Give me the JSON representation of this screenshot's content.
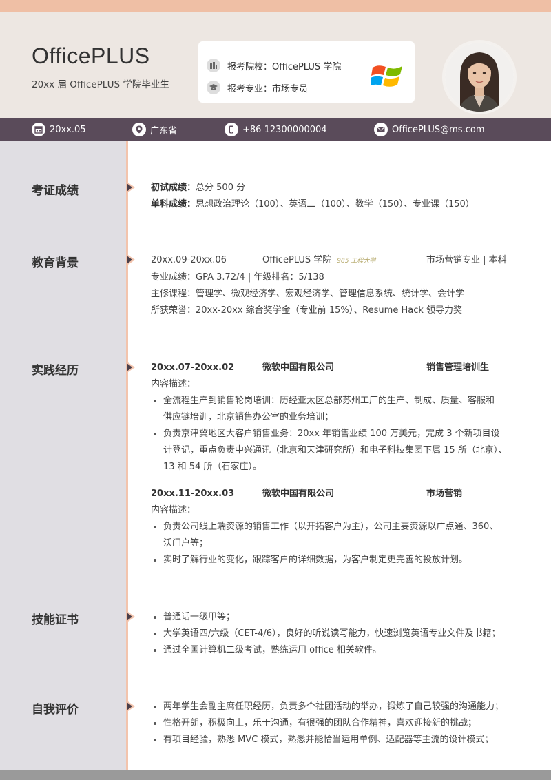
{
  "header": {
    "name": "OfficePLUS",
    "subtitle": "20xx 届 OfficePLUS 学院毕业生",
    "school_label": "报考院校：",
    "school_value": "OfficePLUS 学院",
    "major_label": "报考专业：",
    "major_value": "市场专员"
  },
  "info": {
    "date": "20xx.05",
    "location": "广东省",
    "phone": "+86 12300000004",
    "email": "OfficePLUS@ms.com"
  },
  "sections": {
    "exam": {
      "title": "考证成绩",
      "line1_label": "初试成绩：",
      "line1_value": "总分 500 分",
      "line2_label": "单科成绩：",
      "line2_value": "思想政治理论（100）、英语二（100）、数学（150）、专业课（150）"
    },
    "education": {
      "title": "教育背景",
      "period": "20xx.09-20xx.06",
      "school": "OfficePLUS 学院",
      "tag": "985 工程大学",
      "major": "市场营销专业 | 本科",
      "grades": "专业成绩：GPA 3.72/4 | 年级排名：5/138",
      "courses": "主修课程：管理学、微观经济学、宏观经济学、管理信息系统、统计学、会计学",
      "honors": "所获荣誉：20xx-20xx 综合奖学金（专业前 15%）、Resume Hack 领导力奖"
    },
    "practice": {
      "title": "实践经历",
      "jobs": [
        {
          "period": "20xx.07-20xx.02",
          "company": "微软中国有限公司",
          "role": "销售管理培训生",
          "desc_label": "内容描述：",
          "lines": [
            "全流程生产到销售轮岗培训：历经亚太区总部苏州工厂的生产、制成、质量、客服和",
            "供应链培训，北京销售办公室的业务培训；",
            "负责京津冀地区大客户销售业务：20xx 年销售业绩 100 万美元，完成 3 个新项目设",
            "计登记，重点负责中兴通讯（北京和天津研究所）和电子科技集团下属 15 所（北京）、",
            "13 和 54 所（石家庄）。"
          ]
        },
        {
          "period": "20xx.11-20xx.03",
          "company": "微软中国有限公司",
          "role": "市场营销",
          "desc_label": "内容描述：",
          "lines": [
            "负责公司线上端资源的销售工作（以开拓客户为主），公司主要资源以广点通、360、",
            "沃门户等；",
            "实时了解行业的变化，跟踪客户的详细数据，为客户制定更完善的投放计划。"
          ]
        }
      ]
    },
    "skills": {
      "title": "技能证书",
      "items": [
        "普通话一级甲等；",
        "大学英语四/六级（CET-4/6），良好的听说读写能力，快速浏览英语专业文件及书籍；",
        "通过全国计算机二级考试，熟练运用 office 相关软件。"
      ]
    },
    "self": {
      "title": "自我评价",
      "items": [
        "两年学生会副主席任职经历，负责多个社团活动的举办，锻炼了自己较强的沟通能力；",
        "性格开朗，积极向上，乐于沟通，有很强的团队合作精神，喜欢迎接新的挑战；",
        "有项目经验，熟悉 MVC 模式，熟悉并能恰当运用单例、适配器等主流的设计模式；"
      ]
    }
  },
  "colors": {
    "accent_top": "#efbfa5",
    "header_bg": "#ede7e2",
    "info_bar": "#5a4b5a",
    "sidebar": "#e0dee3",
    "divider": "#f3c4ad"
  }
}
